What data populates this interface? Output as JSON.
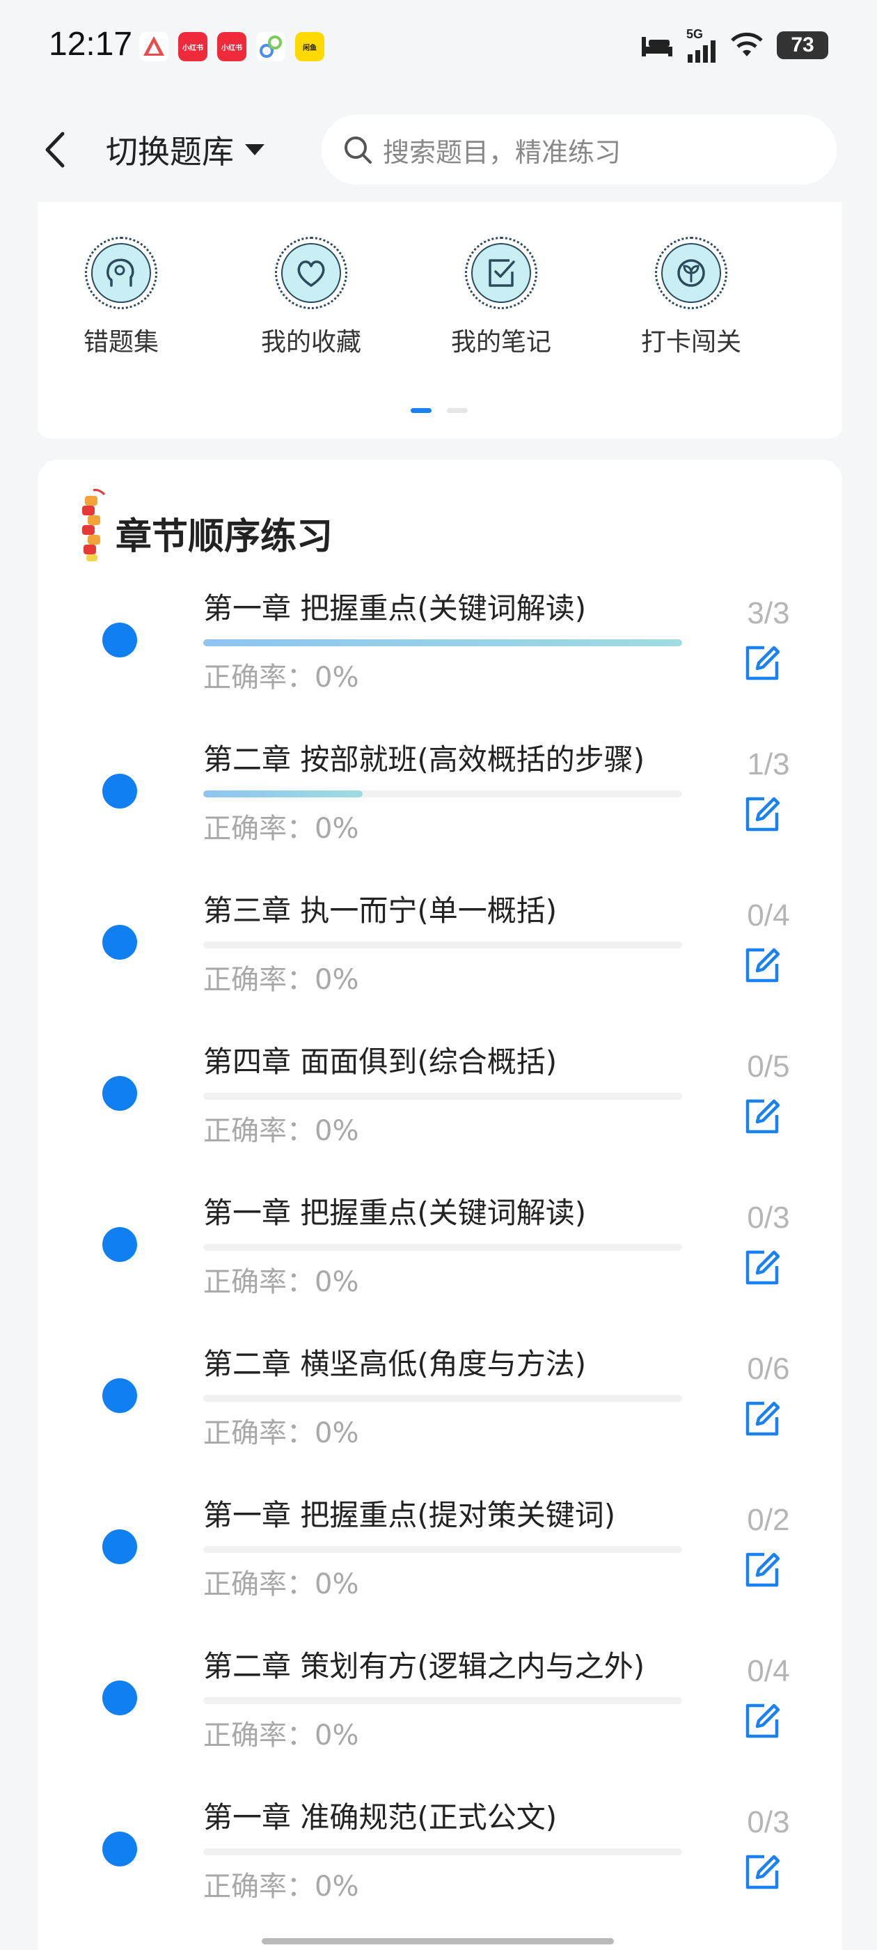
{
  "status_bar": {
    "time": "12:17",
    "battery": "73",
    "notifications": [
      {
        "icon": "notification-app-icon",
        "text": "",
        "color": "#e94c4c"
      },
      {
        "icon": "xiaohongshu-icon",
        "text": "小红书",
        "color": "#ee2a3b"
      },
      {
        "icon": "xiaohongshu-icon",
        "text": "小红书",
        "color": "#ee2a3b"
      },
      {
        "icon": "app-icon",
        "text": "",
        "color": "#4b8df5"
      },
      {
        "icon": "app-icon",
        "text": "闲鱼",
        "color": "#ffd900"
      }
    ],
    "network": "5G"
  },
  "header": {
    "switch_label": "切换题库",
    "search_placeholder": "搜索题目，精准练习"
  },
  "quick_actions": [
    {
      "label": "错题集",
      "icon": "head-icon"
    },
    {
      "label": "我的收藏",
      "icon": "heart-icon"
    },
    {
      "label": "我的笔记",
      "icon": "note-check-icon"
    },
    {
      "label": "打卡闯关",
      "icon": "sprout-icon"
    }
  ],
  "pager": {
    "pages": 2,
    "active": 0
  },
  "chapter_section": {
    "title": "章节顺序练习",
    "accuracy_prefix": "正确率：",
    "chapters": [
      {
        "title": "第一章 把握重点(关键词解读)",
        "done": 3,
        "total": 3,
        "count": "3/3",
        "accuracy": "0%"
      },
      {
        "title": "第二章 按部就班(高效概括的步骤)",
        "done": 1,
        "total": 3,
        "count": "1/3",
        "accuracy": "0%"
      },
      {
        "title": "第三章 执一而宁(单一概括)",
        "done": 0,
        "total": 4,
        "count": "0/4",
        "accuracy": "0%"
      },
      {
        "title": "第四章 面面俱到(综合概括)",
        "done": 0,
        "total": 5,
        "count": "0/5",
        "accuracy": "0%"
      },
      {
        "title": "第一章 把握重点(关键词解读)",
        "done": 0,
        "total": 3,
        "count": "0/3",
        "accuracy": "0%"
      },
      {
        "title": "第二章 横坚高低(角度与方法)",
        "done": 0,
        "total": 6,
        "count": "0/6",
        "accuracy": "0%"
      },
      {
        "title": "第一章 把握重点(提对策关键词)",
        "done": 0,
        "total": 2,
        "count": "0/2",
        "accuracy": "0%"
      },
      {
        "title": "第二章 策划有方(逻辑之内与之外)",
        "done": 0,
        "total": 4,
        "count": "0/4",
        "accuracy": "0%"
      },
      {
        "title": "第一章 准确规范(正式公文)",
        "done": 0,
        "total": 3,
        "count": "0/3",
        "accuracy": "0%"
      }
    ]
  },
  "colors": {
    "accent": "#0f7ff2",
    "progress_start": "#8ec4f0",
    "progress_end": "#9fdbe0",
    "icon_fill": "#c9eef4"
  }
}
